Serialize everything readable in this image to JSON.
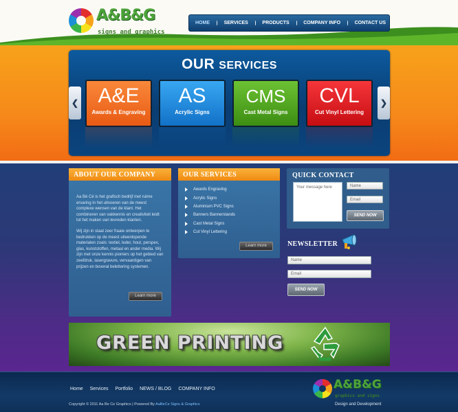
{
  "header": {
    "logo_mark": "A&B&G",
    "logo_tagline": "signs and graphics",
    "nav": [
      {
        "label": "HOME",
        "active": true
      },
      {
        "label": "SERVICES",
        "active": false
      },
      {
        "label": "PRODUCTS",
        "active": false
      },
      {
        "label": "COMPANY INFO",
        "active": false
      },
      {
        "label": "CONTACT US",
        "active": false
      }
    ]
  },
  "banner": {
    "title_word1": "OUR",
    "title_word2": "SERVICES",
    "prev_icon": "chevron-left-icon",
    "next_icon": "chevron-right-icon",
    "tiles": [
      {
        "abbr": "A&E",
        "label": "Awards & Engraving",
        "color": "#f26d1f"
      },
      {
        "abbr": "AS",
        "label": "Acrylic Signs",
        "color": "#1c8fe0"
      },
      {
        "abbr": "CMS",
        "label": "Cast Metal Signs",
        "color": "#4ea51c"
      },
      {
        "abbr": "CVL",
        "label": "Cut Vinyl Lettering",
        "color": "#e8141a"
      }
    ]
  },
  "about": {
    "heading": "ABOUT OUR COMPANY",
    "para1": "Aa Bé Cé is het grafisch bedrijf met ruime ervaring in het uitvoeren van de meest complexe wensen van de klant. Het combineren van vakkennis en creativiteit leidt tot het maken van tevreden klanten.",
    "para2": "Wij zijn in staat zeer fraaie ontwerpen te bedrukken op de meest uiteenlopende materialen zoals: textiel, leder, hout, perspex, glas, kunststoffen, metaal en ander media. Wij zijn met onze kennis pioniers op het gebied van zeefdruk, lasergravure, vervaardigen van prijzen en boveral belettering systemen.",
    "button": "Learn more"
  },
  "services": {
    "heading": "OUR SERVICES",
    "items": [
      "Awards   Engraving",
      "Acrylic Signs",
      "Aluminium   PVC Signs",
      "Banners   Bannerstands",
      "Cast Metal Signs",
      "Cut Vinyl Lettering"
    ],
    "button": "Learn more"
  },
  "quick_contact": {
    "heading": "QUICK CONTACT",
    "message_placeholder": "Your message here",
    "name_placeholder": "Name",
    "email_placeholder": "Email",
    "button": "SEND NOW"
  },
  "newsletter": {
    "heading": "NEWSLETTER",
    "icon": "megaphone-icon",
    "name_placeholder": "Name",
    "email_placeholder": "Email",
    "button": "SEND NOW"
  },
  "green_banner": {
    "text": "GREEN PRINTING",
    "icon": "recycle-icon"
  },
  "footer": {
    "links": [
      "Home",
      "Services",
      "Portfolio",
      "NEWS / BLOG",
      "COMPANY INFO"
    ],
    "copyright": "Copyright © 2011 Aa Be Ce Graphics | Powered By",
    "powered_by": "AaBeCe Signs & Graphics",
    "design": "Design and Development",
    "logo_mark": "A&B&G",
    "logo_tagline": "graphics and signs"
  }
}
